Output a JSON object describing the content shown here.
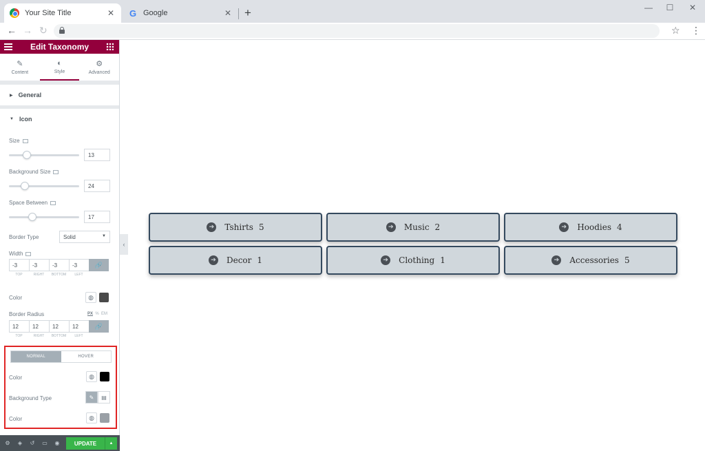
{
  "browser": {
    "tabs": [
      {
        "title": "Your Site Title",
        "close": "✕"
      },
      {
        "title": "Google",
        "close": "✕"
      }
    ],
    "new_tab": "+"
  },
  "panel": {
    "title": "Edit Taxonomy",
    "tabs": [
      {
        "label": "Content",
        "icon": "pencil-icon"
      },
      {
        "label": "Style",
        "icon": "contrast-icon"
      },
      {
        "label": "Advanced",
        "icon": "gear-icon"
      }
    ],
    "sections": {
      "general": "General",
      "icon": "Icon"
    },
    "size": {
      "label": "Size",
      "value": "13",
      "slider_pct": 0.25
    },
    "background_size": {
      "label": "Background Size",
      "value": "24",
      "slider_pct": 0.23
    },
    "space_between": {
      "label": "Space Between",
      "value": "17",
      "slider_pct": 0.33
    },
    "border_type": {
      "label": "Border Type",
      "value": "Solid"
    },
    "width": {
      "label": "Width",
      "values": [
        "-3",
        "-3",
        "-3",
        "-3"
      ],
      "sides": [
        "TOP",
        "RIGHT",
        "BOTTOM",
        "LEFT"
      ]
    },
    "color": {
      "label": "Color",
      "swatch": "#4a4a4a"
    },
    "border_radius": {
      "label": "Border Radius",
      "units": [
        "PX",
        "%",
        "EM"
      ],
      "values": [
        "12",
        "12",
        "12",
        "12"
      ],
      "sides": [
        "TOP",
        "RIGHT",
        "BOTTOM",
        "LEFT"
      ]
    },
    "state_tabs": {
      "normal": "NORMAL",
      "hover": "HOVER"
    },
    "normal_color": {
      "label": "Color",
      "swatch": "#000000"
    },
    "background_type": {
      "label": "Background Type"
    },
    "bg_color": {
      "label": "Color",
      "swatch": "#9aa0a6"
    },
    "update_label": "UPDATE"
  },
  "taxonomy_items": [
    {
      "name": "Tshirts",
      "count": "5"
    },
    {
      "name": "Music",
      "count": "2"
    },
    {
      "name": "Hoodies",
      "count": "4"
    },
    {
      "name": "Decor",
      "count": "1"
    },
    {
      "name": "Clothing",
      "count": "1"
    },
    {
      "name": "Accessories",
      "count": "5"
    }
  ],
  "colors": {
    "brand": "#93003c",
    "item_bg": "#d0d7dc",
    "item_border": "#34495e",
    "update_green": "#39b54a",
    "highlight": "#e02424"
  }
}
